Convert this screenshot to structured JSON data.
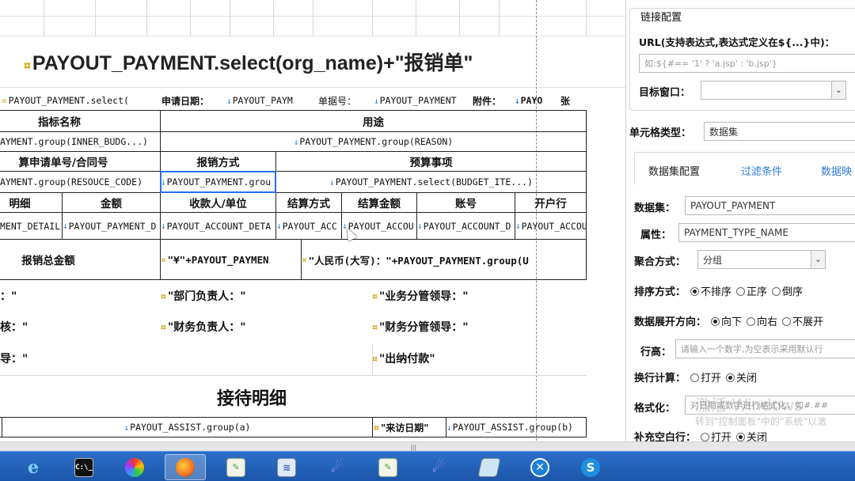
{
  "sheet": {
    "title": "PAYOUT_PAYMENT.select(org_name)+\"报销单\"",
    "row1": {
      "c1": "PAYOUT_PAYMENT.select(",
      "apply_date_label": "申请日期：",
      "apply_date_val": "PAYOUT_PAYM",
      "doc_no_label": "单据号：",
      "doc_no_val": "PAYOUT_PAYMENT",
      "attach_label": "附件：",
      "attach_val": "PAYO",
      "zhang": "张"
    },
    "row2": {
      "indicator": "指标名称",
      "purpose": "用途"
    },
    "row3": {
      "inner_budget": "AYMENT.group(INNER_BUDG...)",
      "reason": "PAYOUT_PAYMENT.group(REASON)"
    },
    "row4": {
      "apply_no": "算申请单号/合同号",
      "pay_method": "报销方式",
      "budget_item": "预算事项"
    },
    "row5": {
      "resource_code": "AYMENT.group(RESOUCE_CODE)",
      "pay_method_val": "PAYOUT_PAYMENT.grou",
      "budget_item_val": "PAYOUT_PAYMENT.select(BUDGET_ITE...)"
    },
    "row6": {
      "detail": "明细",
      "amount": "金额",
      "payee": "收款人/单位",
      "settle_method": "结算方式",
      "settle_amount": "结算金额",
      "account_no": "账号",
      "bank": "开户行"
    },
    "row7": {
      "detail": "MENT_DETAIL",
      "amount": "PAYOUT_PAYMENT_D",
      "payee": "PAYOUT_ACCOUNT_DETA",
      "settle_method": "PAYOUT_ACC",
      "settle_amount": "PAYOUT_ACCOU",
      "account_no": "PAYOUT_ACCOUNT_D",
      "bank": "PAYOUT_ACCOU"
    },
    "row8": {
      "total_label": "报销总金额",
      "total_expr": "\"¥\"+PAYOUT_PAYMEN",
      "rmb_expr": "\"人民币(大写)：\"+PAYOUT_PAYMENT.group(U"
    },
    "row9": {
      "c1": "：\"",
      "dept_head": "\"部门负责人：\"",
      "biz_leader": "\"业务分管领导：\""
    },
    "row10": {
      "c1": "核：\"",
      "fin_head": "\"财务负责人：\"",
      "fin_leader": "\"财务分管领导：\""
    },
    "row11": {
      "c1": "导：\"",
      "cashier": "\"出纳付款\""
    },
    "subtitle": "接待明细",
    "row12": {
      "assist_a": "PAYOUT_ASSIST.group(a)",
      "visit_date": "\"来访日期\"",
      "assist_b": "PAYOUT_ASSIST.group(b)"
    }
  },
  "panel": {
    "link_group": "链接配置",
    "url_label": "URL(支持表达式,表达式定义在${...}中)：",
    "url_placeholder": "如:${#== '1' ? 'a.jsp' : 'b.jsp'}",
    "target_label": "目标窗口：",
    "cell_type_label": "单元格类型：",
    "cell_type_value": "数据集",
    "tabs": [
      "数据集配置",
      "过滤条件",
      "数据映"
    ],
    "dataset_label": "数据集：",
    "dataset_value": "PAYOUT_PAYMENT",
    "attr_label": "属性：",
    "attr_value": "PAYMENT_TYPE_NAME",
    "agg_label": "聚合方式：",
    "agg_value": "分组",
    "sort_label": "排序方式：",
    "sort_options": [
      "不排序",
      "正序",
      "倒序"
    ],
    "expand_label": "数据展开方向：",
    "expand_options": [
      "向下",
      "向右",
      "不展开"
    ],
    "row_height_label": "行高：",
    "row_height_placeholder": "请输入一个数字,为空表示采用默认行",
    "wrap_label": "换行计算：",
    "wrap_options": [
      "打开",
      "关闭"
    ],
    "format_label": "格式化：",
    "format_placeholder": "对日期或数字进行格式化，如#.##",
    "fill_label": "补充空白行：",
    "fill_options": [
      "打开",
      "关闭"
    ],
    "watermark_1": "激活 Windows",
    "watermark_2": "转到\"控制面板\"中的\"系统\"以激"
  },
  "taskbar": {
    "icons": [
      "ie-icon",
      "cmd-icon",
      "picasa-icon",
      "firefox-icon",
      "editor-icon",
      "monitor-icon",
      "eclipse-icon",
      "editor2-icon",
      "eclipse2-icon",
      "notebook-icon",
      "tools-icon",
      "s-app-icon"
    ],
    "colors": {
      "bar": "#1f5fb8",
      "accent": "#2a6ff0"
    }
  }
}
